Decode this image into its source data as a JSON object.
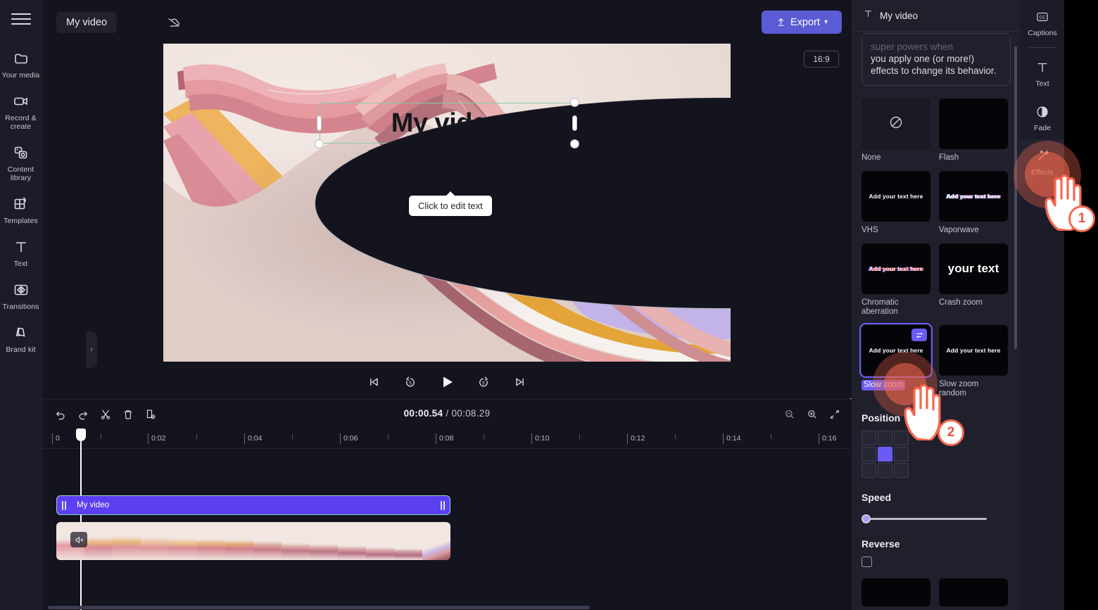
{
  "app": {
    "project_name": "My video",
    "cloud_icon": "cloud-off-icon",
    "export_label": "Export",
    "export_chevron": "▾",
    "menu_icon": "hamburger-menu-icon"
  },
  "sidebar": {
    "items": [
      {
        "label": "Your media",
        "icon": "folder-icon"
      },
      {
        "label": "Record & create",
        "icon": "video-camera-icon"
      },
      {
        "label": "Content library",
        "icon": "content-library-icon"
      },
      {
        "label": "Templates",
        "icon": "templates-icon"
      },
      {
        "label": "Text",
        "icon": "text-t-icon"
      },
      {
        "label": "Transitions",
        "icon": "transitions-icon"
      },
      {
        "label": "Brand kit",
        "icon": "brand-kit-icon"
      }
    ]
  },
  "stage": {
    "ratio_badge": "16:9",
    "overlay_text": "My video",
    "tooltip": "Click to edit text",
    "collapse_left": "›",
    "collapse_right": "›",
    "help_glyph": "?",
    "help_chevron": "⌄",
    "fullscreen_icon": "fullscreen-icon",
    "controls": [
      {
        "name": "skip-to-start-button",
        "icon": "skip-previous-icon"
      },
      {
        "name": "rewind-5s-button",
        "icon": "replay-5-icon",
        "label": "5"
      },
      {
        "name": "play-button",
        "icon": "play-icon"
      },
      {
        "name": "forward-5s-button",
        "icon": "forward-5-icon",
        "label": "5"
      },
      {
        "name": "skip-to-end-button",
        "icon": "skip-next-icon"
      }
    ]
  },
  "timeline": {
    "current_time": "00:00.54",
    "separator": " / ",
    "total_time": "00:08.29",
    "tools": [
      {
        "name": "undo-button",
        "icon": "undo-icon"
      },
      {
        "name": "redo-button",
        "icon": "redo-icon"
      },
      {
        "name": "split-button",
        "icon": "scissors-icon"
      },
      {
        "name": "delete-button",
        "icon": "trash-icon"
      },
      {
        "name": "duplicate-button",
        "icon": "duplicate-icon"
      }
    ],
    "zoom_tools": [
      {
        "name": "zoom-out-button",
        "icon": "magnifier-minus-icon"
      },
      {
        "name": "zoom-in-button",
        "icon": "magnifier-plus-icon"
      },
      {
        "name": "fit-to-screen-button",
        "icon": "fit-arrows-icon"
      }
    ],
    "ruler_ticks": [
      "0",
      "0:02",
      "0:04",
      "0:06",
      "0:08",
      "0:10",
      "0:12",
      "0:14",
      "0:16"
    ],
    "text_clip_label": "My video",
    "media_clip_mute_icon": "speaker-mute-icon"
  },
  "properties": {
    "header_title": "My video",
    "header_icon": "text-t-icon",
    "promo_line_faded": "super powers when",
    "promo_text": "you apply one (or more!) effects to change its behavior.",
    "effects": [
      {
        "label": "None",
        "kind": "none",
        "sample": ""
      },
      {
        "label": "Flash",
        "kind": "black",
        "sample": ""
      },
      {
        "label": "VHS",
        "kind": "sample",
        "sample": "Add your text here"
      },
      {
        "label": "Vaporwave",
        "kind": "sample",
        "sample": "Add your text here"
      },
      {
        "label": "Chromatic aberration",
        "kind": "chromatic",
        "sample": "Add your text here"
      },
      {
        "label": "Crash zoom",
        "kind": "crash",
        "sample": "your text"
      },
      {
        "label": "Slow zoom",
        "kind": "sample",
        "sample": "Add your text here",
        "selected": true
      },
      {
        "label": "Slow zoom random",
        "kind": "sample",
        "sample": "Add your text here"
      }
    ],
    "position_label": "Position",
    "position_selected_index": 4,
    "speed_label": "Speed",
    "speed_value": 0,
    "reverse_label": "Reverse",
    "reverse_checked": false
  },
  "tabs": {
    "items": [
      {
        "label": "Captions",
        "icon": "closed-caption-icon"
      },
      {
        "label": "Text",
        "icon": "text-t-icon"
      },
      {
        "label": "Fade",
        "icon": "fade-circle-icon"
      },
      {
        "label": "Effects",
        "icon": "magic-wand-icon",
        "active": true
      }
    ]
  },
  "annotations": {
    "step_one": "1",
    "step_two": "2"
  },
  "colors": {
    "accent": "#5b5bd6",
    "selection": "#6b5bf5",
    "clip": "#5b3ff0",
    "hotspot": "#f4684f",
    "panel_bg": "#20202c",
    "rail_bg": "#1b1b29",
    "app_bg": "#14141f",
    "text_frame": "#8fc9ae"
  }
}
